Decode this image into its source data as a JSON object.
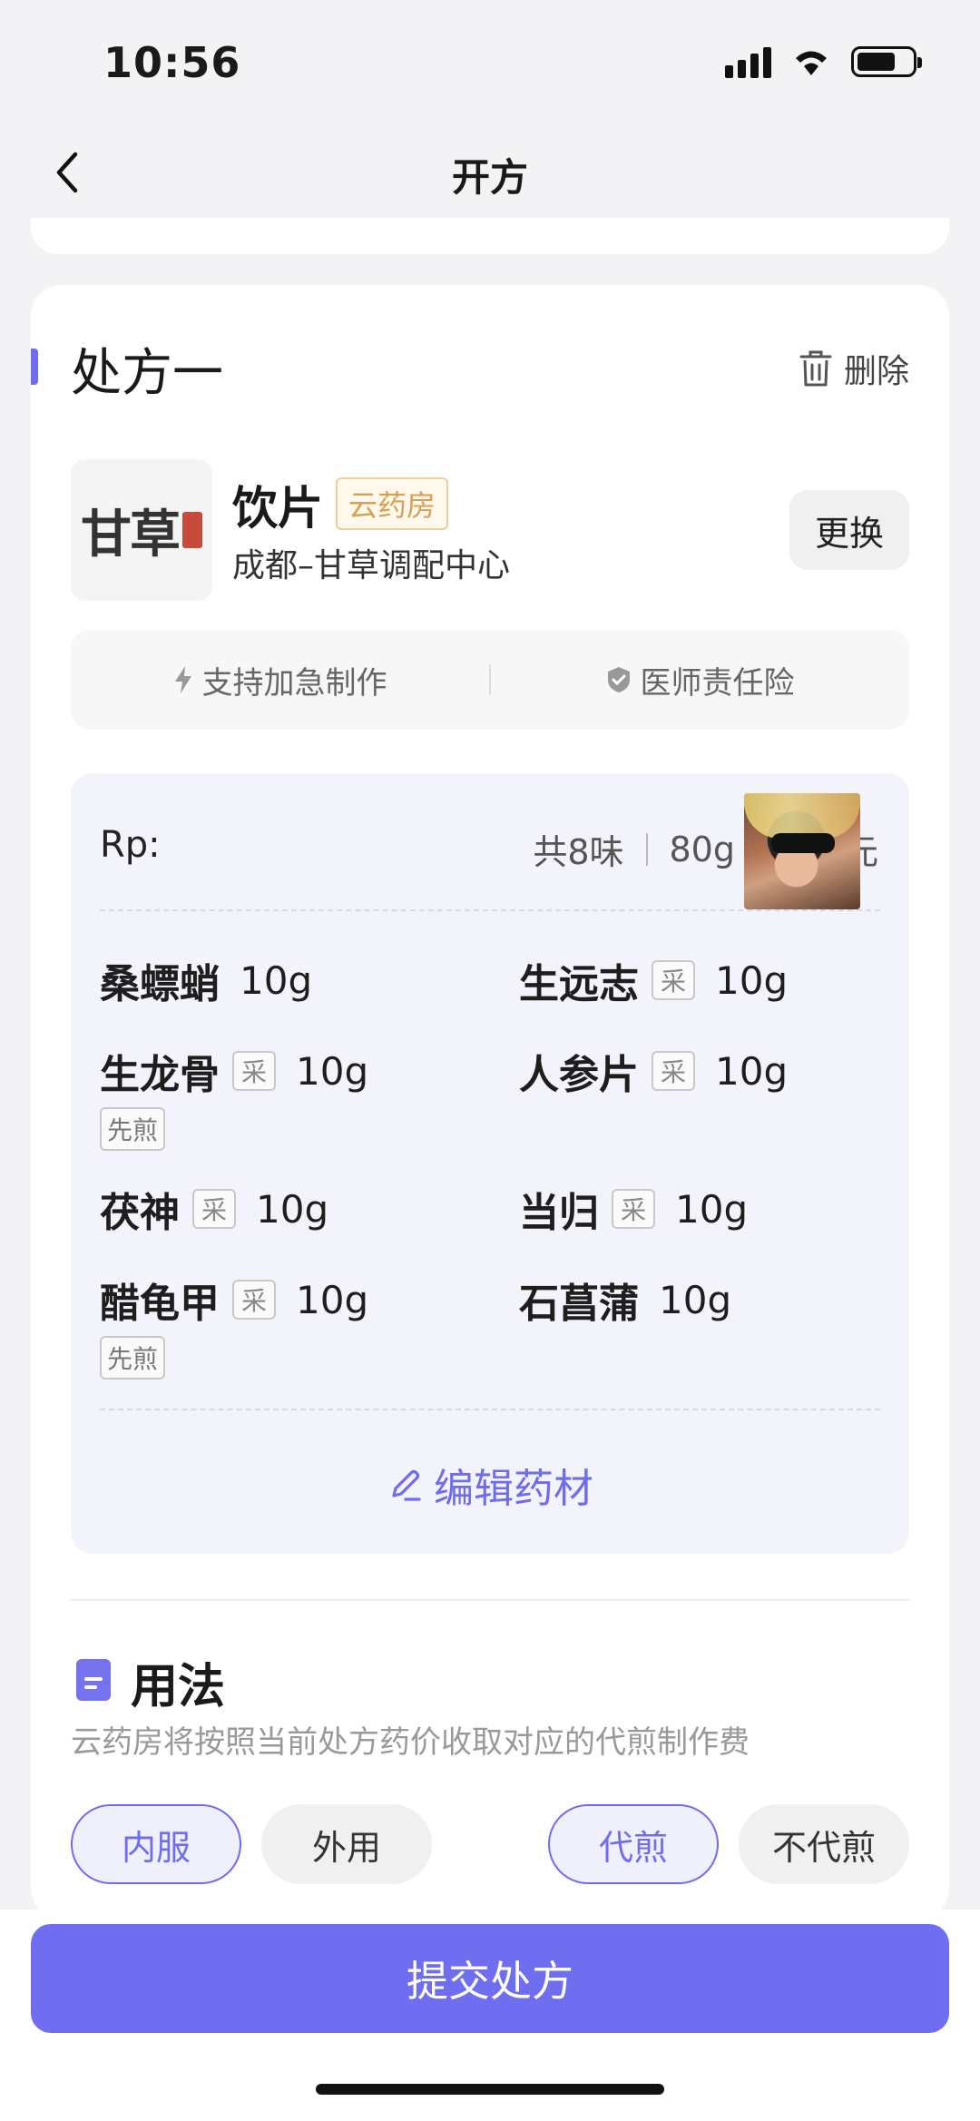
{
  "status": {
    "time": "10:56"
  },
  "nav": {
    "title": "开方"
  },
  "prescription": {
    "title": "处方一",
    "delete_label": "删除",
    "pharmacy": {
      "name": "饮片",
      "tag": "云药房",
      "center": "成都–甘草调配中心",
      "logo_text": "甘草",
      "change_label": "更换"
    },
    "features": [
      "支持加急制作",
      "医师责任险"
    ],
    "rp": {
      "label": "Rp:",
      "count": "共8味",
      "weight": "80g",
      "price_unit": "元"
    },
    "herbs": [
      {
        "name": "桑螵蛸",
        "tag": "",
        "amount": "10g",
        "note": ""
      },
      {
        "name": "生远志",
        "tag": "采",
        "amount": "10g",
        "note": ""
      },
      {
        "name": "生龙骨",
        "tag": "采",
        "amount": "10g",
        "note": "先煎"
      },
      {
        "name": "人参片",
        "tag": "采",
        "amount": "10g",
        "note": ""
      },
      {
        "name": "茯神",
        "tag": "采",
        "amount": "10g",
        "note": ""
      },
      {
        "name": "当归",
        "tag": "采",
        "amount": "10g",
        "note": ""
      },
      {
        "name": "醋龟甲",
        "tag": "采",
        "amount": "10g",
        "note": "先煎"
      },
      {
        "name": "石菖蒲",
        "tag": "",
        "amount": "10g",
        "note": ""
      }
    ],
    "edit_label": "编辑药材"
  },
  "usage": {
    "title": "用法",
    "desc": "云药房将按照当前处方药价收取对应的代煎制作费",
    "options": [
      {
        "label": "内服",
        "selected": true
      },
      {
        "label": "外用",
        "selected": false
      },
      {
        "label": "代煎",
        "selected": true
      },
      {
        "label": "不代煎",
        "selected": false
      }
    ]
  },
  "submit_label": "提交处方",
  "colors": {
    "accent": "#6e6cf0",
    "tag_gold": "#d8a055"
  }
}
